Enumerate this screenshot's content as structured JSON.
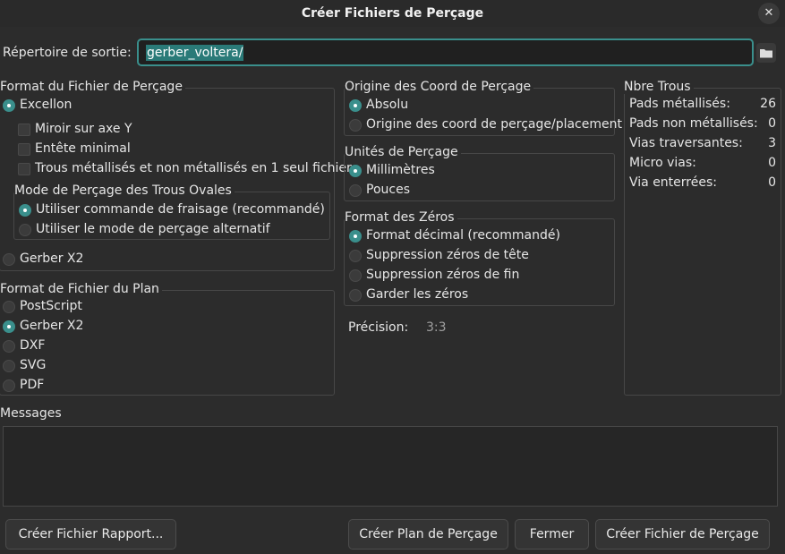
{
  "window": {
    "title": "Créer Fichiers de Perçage",
    "close_symbol": "✕"
  },
  "output": {
    "label": "Répertoire de sortie:",
    "value": "gerber_voltera/"
  },
  "drill_format": {
    "title": "Format du Fichier de Perçage",
    "excellon": "Excellon",
    "mirror_y": "Miroir sur axe Y",
    "minimal_header": "Entête minimal",
    "merge_pth_npth": "Trous métallisés et non métallisés en 1 seul fichier",
    "oval_mode": {
      "title": "Mode de Perçage des Trous Ovales",
      "route": "Utiliser commande de fraisage (recommandé)",
      "alternate": "Utiliser le mode de perçage alternatif"
    },
    "gerber_x2": "Gerber X2"
  },
  "map_format": {
    "title": "Format de Fichier du Plan",
    "options": [
      "PostScript",
      "Gerber X2",
      "DXF",
      "SVG",
      "PDF"
    ],
    "selected": "Gerber X2"
  },
  "origin": {
    "title": "Origine des Coord de Perçage",
    "absolute": "Absolu",
    "aux": "Origine des coord de perçage/placement"
  },
  "units": {
    "title": "Unités de Perçage",
    "mm": "Millimètres",
    "inches": "Pouces"
  },
  "zeros": {
    "title": "Format des Zéros",
    "decimal": "Format décimal (recommandé)",
    "suppress_leading": "Suppression zéros de tête",
    "suppress_trailing": "Suppression zéros de fin",
    "keep": "Garder les zéros"
  },
  "precision": {
    "label": "Précision:",
    "value": "3:3"
  },
  "hole_counts": {
    "title": "Nbre Trous",
    "rows": [
      {
        "label": "Pads métallisés:",
        "value": "26"
      },
      {
        "label": "Pads non métallisés:",
        "value": "0"
      },
      {
        "label": "Vias traversantes:",
        "value": "3"
      },
      {
        "label": "Micro vias:",
        "value": "0"
      },
      {
        "label": "Via enterrées:",
        "value": "0"
      }
    ]
  },
  "messages": {
    "label": "Messages"
  },
  "buttons": {
    "report": "Créer Fichier Rapport...",
    "map": "Créer Plan de Perçage",
    "close": "Fermer",
    "drill": "Créer Fichier de Perçage"
  },
  "colors": {
    "accent": "#3a8f8c",
    "background": "#2c2c2c"
  }
}
